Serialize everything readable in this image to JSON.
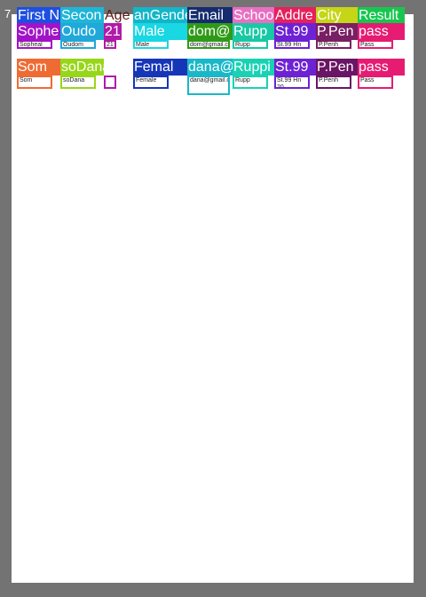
{
  "corner_label": "7",
  "colors": {
    "background": "#737373",
    "page": "#ffffff"
  },
  "headers": [
    {
      "key": "first_name",
      "text": "First N",
      "color": "#1d4fe0"
    },
    {
      "key": "second_name",
      "text": "Secon",
      "color": "#1fb5d8"
    },
    {
      "key": "age",
      "text": "Age",
      "color": "#ffffff"
    },
    {
      "key": "gender",
      "text": "anGende",
      "color": "#12b6c9"
    },
    {
      "key": "email",
      "text": "Email",
      "color": "#152d6e"
    },
    {
      "key": "school",
      "text": "Schoo",
      "color": "#e86fc2"
    },
    {
      "key": "address",
      "text": "Addre",
      "color": "#e4215c"
    },
    {
      "key": "city",
      "text": "City",
      "color": "#c6d516"
    },
    {
      "key": "result",
      "text": "Result",
      "color": "#18c64f"
    }
  ],
  "rows": [
    {
      "first_name": {
        "big": "Sophe",
        "small": "Sopheal",
        "color": "#a213c7"
      },
      "second_name": {
        "big": "Oudo",
        "small": "Oudom",
        "color": "#1fa8d8"
      },
      "age": {
        "big": "21",
        "small": "21",
        "color": "#b11aa8"
      },
      "gender": {
        "big": "Male",
        "small": "Male",
        "color": "#19d7e3"
      },
      "email": {
        "big": "dom@",
        "small": "dom@gmail.c",
        "color": "#2f9a17"
      },
      "school": {
        "big": "Rupp",
        "small": "Rupp",
        "color": "#19c8a5"
      },
      "address": {
        "big": "St.99",
        "small": "St.99 Hn 20",
        "color": "#6d22d4"
      },
      "city": {
        "big": "P.Pen",
        "small": "P.Penh",
        "color": "#7a1f63"
      },
      "result": {
        "big": "pass",
        "small": "Pass",
        "color": "#e51c72"
      }
    },
    {
      "first_name": {
        "big": "Som",
        "small": "Som",
        "color": "#ef6b34"
      },
      "second_name": {
        "big": "soDana",
        "small": "soDana",
        "color": "#98d619"
      },
      "age": {
        "big": "",
        "small": "",
        "color": "#b11aa8"
      },
      "gender": {
        "big": "Femal",
        "small": "Female",
        "color": "#1636b8"
      },
      "email": {
        "big": "dana@",
        "small": "dana@gmail.com",
        "color": "#19b8c8"
      },
      "school": {
        "big": "Ruppi",
        "small": "Rupp",
        "color": "#19d2b4"
      },
      "address": {
        "big": "St.99",
        "small": "St.99 Hn 20",
        "color": "#6d22d4"
      },
      "city": {
        "big": "P.Pen",
        "small": "P.Penh",
        "color": "#6a1565"
      },
      "result": {
        "big": "pass",
        "small": "Pass",
        "color": "#e51c72"
      }
    }
  ]
}
